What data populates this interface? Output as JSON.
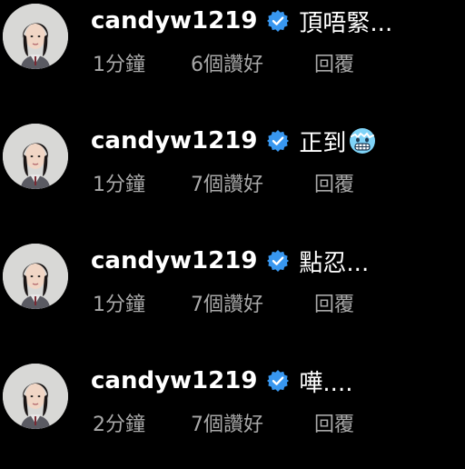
{
  "colors": {
    "background": "#000000",
    "username": "#ffffff",
    "meta_text": "#a8a8a8",
    "verified_badge": "#3897f0"
  },
  "comments": [
    {
      "username": "candyw1219",
      "text": "頂唔緊...",
      "emoji": "",
      "time": "1分鐘",
      "likes": "6個讚好",
      "reply_label": "回覆"
    },
    {
      "username": "candyw1219",
      "text": "正到",
      "emoji": "cold-face-emoji",
      "time": "1分鐘",
      "likes": "7個讚好",
      "reply_label": "回覆"
    },
    {
      "username": "candyw1219",
      "text": "點忍...",
      "emoji": "",
      "time": "1分鐘",
      "likes": "7個讚好",
      "reply_label": "回覆"
    },
    {
      "username": "candyw1219",
      "text": "嘩....",
      "emoji": "",
      "time": "2分鐘",
      "likes": "7個讚好",
      "reply_label": "回覆"
    }
  ],
  "icons": {
    "avatar": "avatar-photo",
    "verified": "verified-badge-icon"
  }
}
